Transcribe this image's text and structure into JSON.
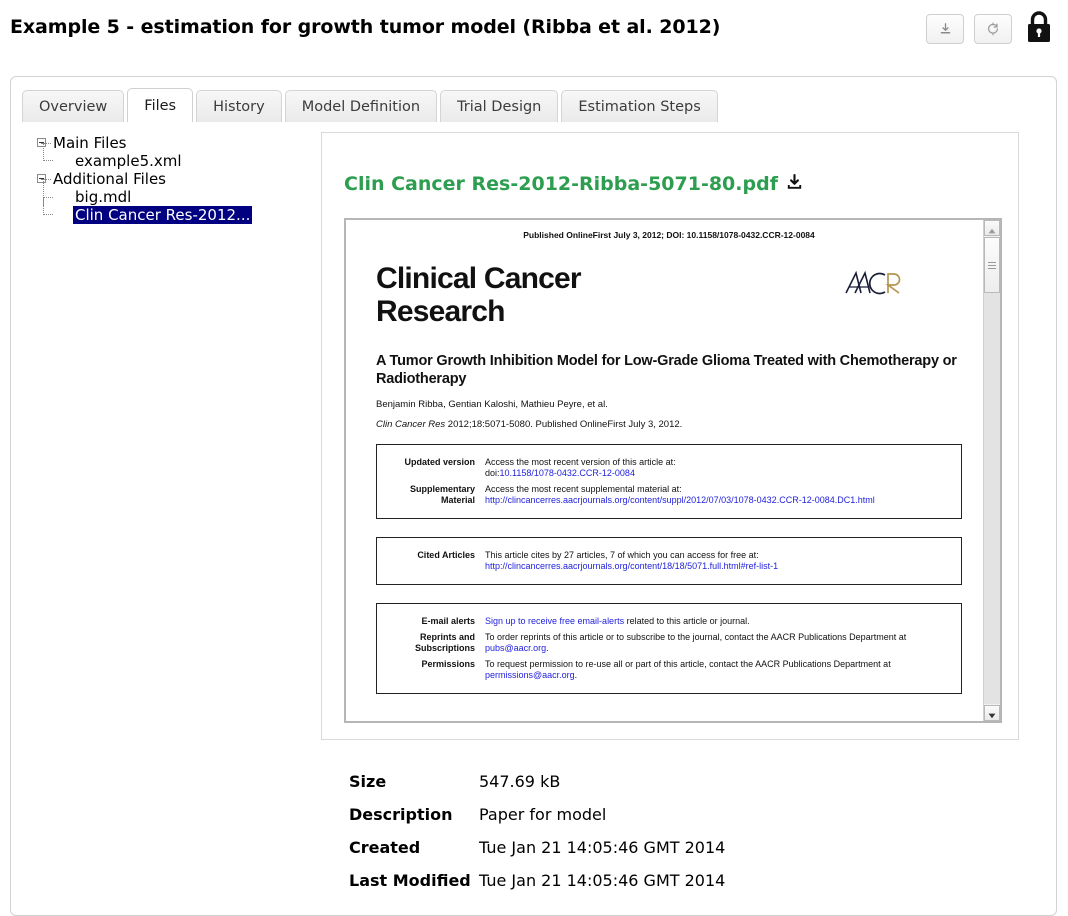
{
  "header": {
    "title": "Example 5 - estimation for growth tumor model (Ribba et al. 2012)",
    "download_icon": "download-icon",
    "refresh_icon": "refresh-icon",
    "lock_icon": "lock-icon"
  },
  "tabs": [
    {
      "label": "Overview",
      "active": false
    },
    {
      "label": "Files",
      "active": true
    },
    {
      "label": "History",
      "active": false
    },
    {
      "label": "Model Definition",
      "active": false
    },
    {
      "label": "Trial Design",
      "active": false
    },
    {
      "label": "Estimation Steps",
      "active": false
    }
  ],
  "tree": {
    "main_files_label": "Main Files",
    "example_xml_label": "example5.xml",
    "additional_files_label": "Additional Files",
    "big_mdl_label": "big.mdl",
    "selected_file_label": "Clin Cancer Res-2012...",
    "selection_color": "#000080"
  },
  "preview": {
    "file_name": "Clin Cancer Res-2012-Ribba-5071-80.pdf",
    "file_name_color": "#2d9e4f",
    "download_icon": "download-icon"
  },
  "pdf": {
    "published_line": "Published OnlineFirst July 3, 2012; DOI: 10.1158/1078-0432.CCR-12-0084",
    "journal_line1": "Clinical Cancer",
    "journal_line2": "Research",
    "logo": "aacr-logo",
    "article_title": "A Tumor Growth Inhibition Model for Low-Grade Glioma Treated with Chemotherapy or Radiotherapy",
    "authors": "Benjamin Ribba, Gentian Kaloshi, Mathieu Peyre, et al.",
    "citation_italic": "Clin Cancer Res",
    "citation_rest": " 2012;18:5071-5080. Published OnlineFirst July 3, 2012.",
    "boxes": [
      {
        "rows": [
          {
            "label": "Updated version",
            "text": "Access the most recent version of this article at:",
            "prefix": "doi:",
            "link": "10.1158/1078-0432.CCR-12-0084"
          },
          {
            "label": "Supplementary\nMaterial",
            "text": "Access the most recent supplemental material at:",
            "prefix": "",
            "link": "http://clincancerres.aacrjournals.org/content/suppl/2012/07/03/1078-0432.CCR-12-0084.DC1.html"
          }
        ]
      },
      {
        "rows": [
          {
            "label": "Cited Articles",
            "text": "This article cites by 27 articles, 7 of which you can access for free at:",
            "prefix": "",
            "link": "http://clincancerres.aacrjournals.org/content/18/18/5071.full.html#ref-list-1"
          }
        ]
      },
      {
        "rows": [
          {
            "label": "E-mail alerts",
            "link_first": "Sign up to receive free email-alerts",
            "text_after": " related to this article or journal."
          },
          {
            "label": "Reprints and\nSubscriptions",
            "text": "To order reprints of this article or to subscribe to the journal, contact the AACR Publications Department at",
            "prefix": "",
            "link": "pubs@aacr.org",
            "suffix": "."
          },
          {
            "label": "Permissions",
            "text": "To request permission to re-use all or part of this article, contact the AACR Publications Department at",
            "prefix": "",
            "link": "permissions@aacr.org",
            "suffix": "."
          }
        ]
      }
    ],
    "scrollbar": {
      "up_icon": "scroll-up-arrow-icon",
      "down_icon": "scroll-down-arrow-icon",
      "thumb": "scrollbar-thumb"
    }
  },
  "metadata": [
    {
      "key": "Size",
      "value": "547.69 kB"
    },
    {
      "key": "Description",
      "value": "Paper for model"
    },
    {
      "key": "Created",
      "value": "Tue Jan 21 14:05:46 GMT 2014"
    },
    {
      "key": "Last Modified",
      "value": "Tue Jan 21 14:05:46 GMT 2014"
    }
  ]
}
